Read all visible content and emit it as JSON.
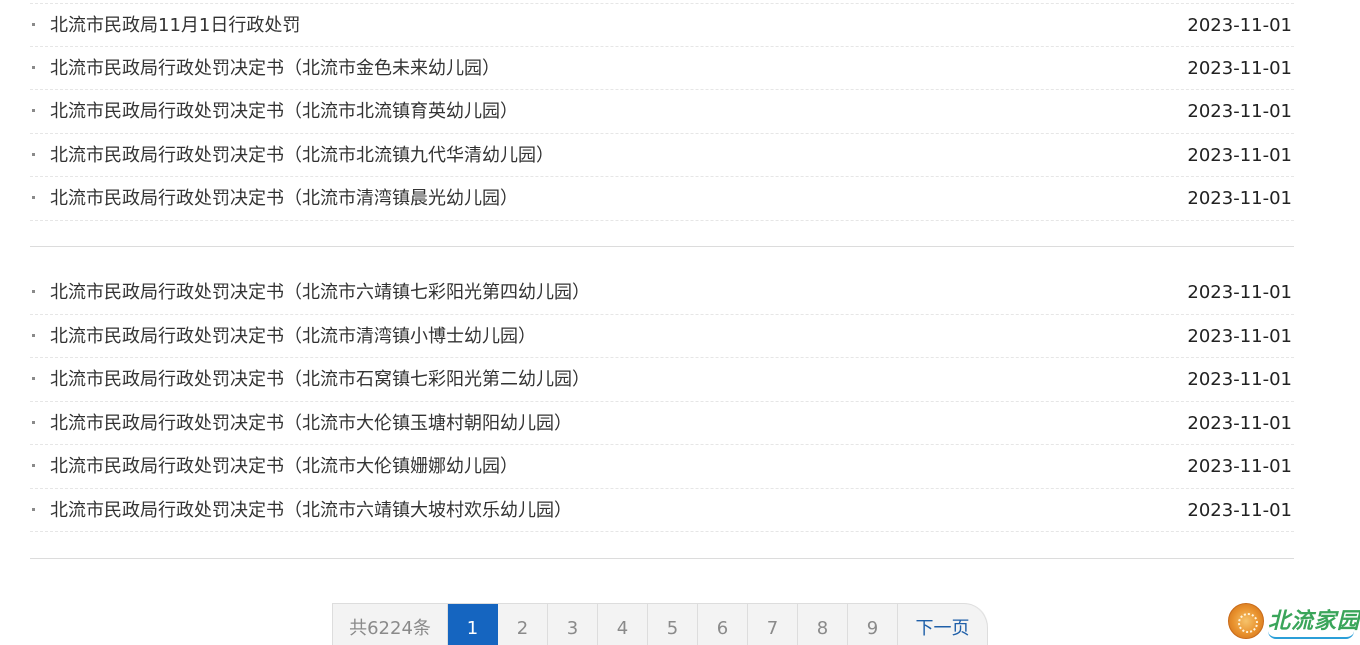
{
  "news_list_a": [
    {
      "title": "北流市民政局11月1日行政处罚",
      "date": "2023-11-01"
    },
    {
      "title": "北流市民政局行政处罚决定书（北流市金色未来幼儿园）",
      "date": "2023-11-01"
    },
    {
      "title": "北流市民政局行政处罚决定书（北流市北流镇育英幼儿园）",
      "date": "2023-11-01"
    },
    {
      "title": "北流市民政局行政处罚决定书（北流市北流镇九代华清幼儿园）",
      "date": "2023-11-01"
    },
    {
      "title": "北流市民政局行政处罚决定书（北流市清湾镇晨光幼儿园）",
      "date": "2023-11-01"
    }
  ],
  "news_list_b": [
    {
      "title": "北流市民政局行政处罚决定书（北流市六靖镇七彩阳光第四幼儿园）",
      "date": "2023-11-01"
    },
    {
      "title": "北流市民政局行政处罚决定书（北流市清湾镇小博士幼儿园）",
      "date": "2023-11-01"
    },
    {
      "title": "北流市民政局行政处罚决定书（北流市石窝镇七彩阳光第二幼儿园）",
      "date": "2023-11-01"
    },
    {
      "title": "北流市民政局行政处罚决定书（北流市大伦镇玉塘村朝阳幼儿园）",
      "date": "2023-11-01"
    },
    {
      "title": "北流市民政局行政处罚决定书（北流市大伦镇姗娜幼儿园）",
      "date": "2023-11-01"
    },
    {
      "title": "北流市民政局行政处罚决定书（北流市六靖镇大坡村欢乐幼儿园）",
      "date": "2023-11-01"
    }
  ],
  "pagination": {
    "total_label": "共6224条",
    "current_page": "1",
    "pages": [
      "1",
      "2",
      "3",
      "4",
      "5",
      "6",
      "7",
      "8",
      "9"
    ],
    "next_label": "下一页",
    "accent_color": "#1565c0"
  },
  "logo": {
    "text": "北流家园",
    "icon": "seal-icon"
  }
}
